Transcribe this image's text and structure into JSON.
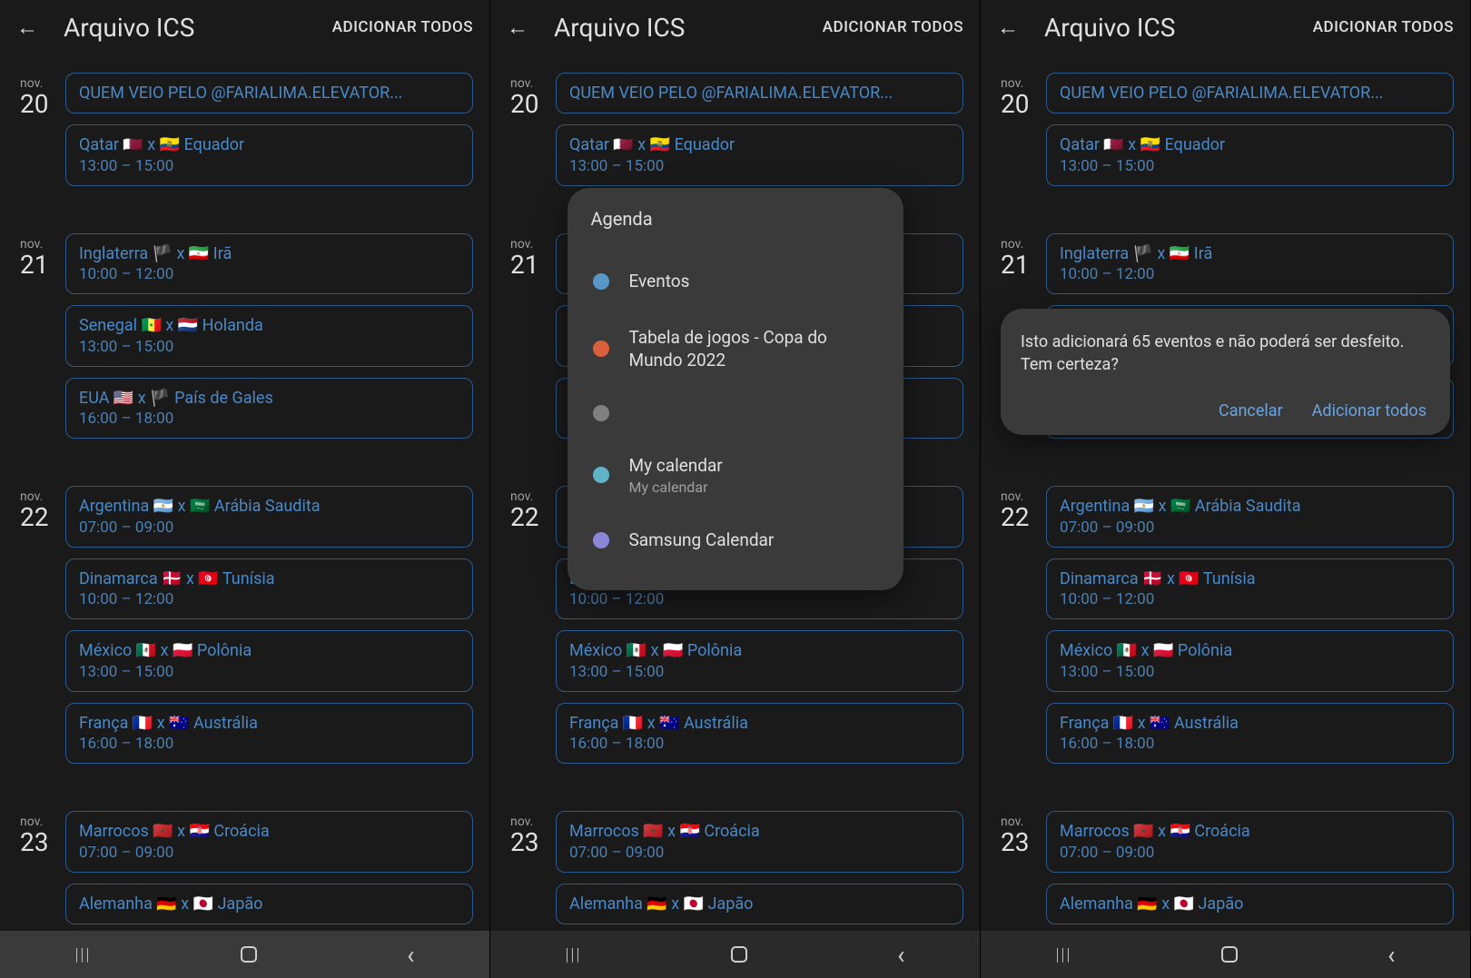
{
  "header": {
    "title": "Arquivo ICS",
    "add_all": "ADICIONAR TODOS"
  },
  "days": [
    {
      "month": "nov.",
      "day": "20",
      "events": [
        {
          "title": "QUEM VEIO PELO @FARIALIMA.ELEVATOR...",
          "time": ""
        },
        {
          "title": "Qatar 🇶🇦 x 🇪🇨 Equador",
          "time": "13:00 – 15:00"
        }
      ]
    },
    {
      "month": "nov.",
      "day": "21",
      "events": [
        {
          "title": "Inglaterra 🏴 x 🇮🇷 Irã",
          "time": "10:00 – 12:00"
        },
        {
          "title": "Senegal 🇸🇳 x 🇳🇱 Holanda",
          "time": "13:00 – 15:00"
        },
        {
          "title": "EUA 🇺🇸 x 🏴 País de Gales",
          "time": "16:00 – 18:00"
        }
      ]
    },
    {
      "month": "nov.",
      "day": "22",
      "events": [
        {
          "title": "Argentina 🇦🇷 x 🇸🇦 Arábia Saudita",
          "time": "07:00 – 09:00"
        },
        {
          "title": "Dinamarca 🇩🇰 x 🇹🇳 Tunísia",
          "time": "10:00 – 12:00"
        },
        {
          "title": "México 🇲🇽 x 🇵🇱 Polônia",
          "time": "13:00 – 15:00"
        },
        {
          "title": "França 🇫🇷 x 🇦🇺 Austrália",
          "time": "16:00 – 18:00"
        }
      ]
    },
    {
      "month": "nov.",
      "day": "23",
      "events": [
        {
          "title": "Marrocos 🇲🇦 x 🇭🇷 Croácia",
          "time": "07:00 – 09:00"
        },
        {
          "title": "Alemanha 🇩🇪 x 🇯🇵 Japão",
          "time": ""
        }
      ]
    }
  ],
  "agenda": {
    "title": "Agenda",
    "items": [
      {
        "label": "Eventos",
        "sub": "",
        "color": "#5896c8"
      },
      {
        "label": "Tabela de jogos - Copa do Mundo 2022",
        "sub": "",
        "color": "#d9603b"
      },
      {
        "label": "",
        "sub": "",
        "color": "#808080"
      },
      {
        "label": "My calendar",
        "sub": "My calendar",
        "color": "#5fb3c9"
      },
      {
        "label": "Samsung Calendar",
        "sub": "",
        "color": "#8a86d9"
      }
    ]
  },
  "confirm": {
    "text": "Isto adicionará 65 eventos e não poderá ser desfeito. Tem certeza?",
    "cancel": "Cancelar",
    "add": "Adicionar todos"
  },
  "middle_bottom_event": {
    "time": "16:00 – 18:00"
  }
}
